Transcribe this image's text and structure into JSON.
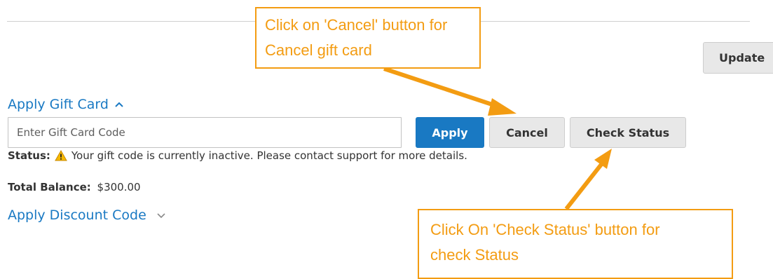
{
  "cart": {
    "update_label": "Update"
  },
  "gift_card": {
    "heading": "Apply Gift Card",
    "input_placeholder": "Enter Gift Card Code",
    "apply_label": "Apply",
    "cancel_label": "Cancel",
    "check_status_label": "Check Status",
    "status_label": "Status:",
    "status_message": "Your gift code is currently inactive. Please contact support for more details.",
    "status_icon": "warning-icon",
    "balance_label": "Total Balance:",
    "balance_value": "$300.00"
  },
  "discount": {
    "heading": "Apply Discount Code"
  },
  "annotations": {
    "cancel_callout_lines": [
      "Click on 'Cancel' button for",
      "Cancel gift card"
    ],
    "check_callout_lines": [
      "Click On 'Check Status' button for",
      "check Status"
    ]
  },
  "colors": {
    "link_blue": "#1979c3",
    "annotation_orange": "#f39c12",
    "button_gray": "#e8e8e8"
  }
}
